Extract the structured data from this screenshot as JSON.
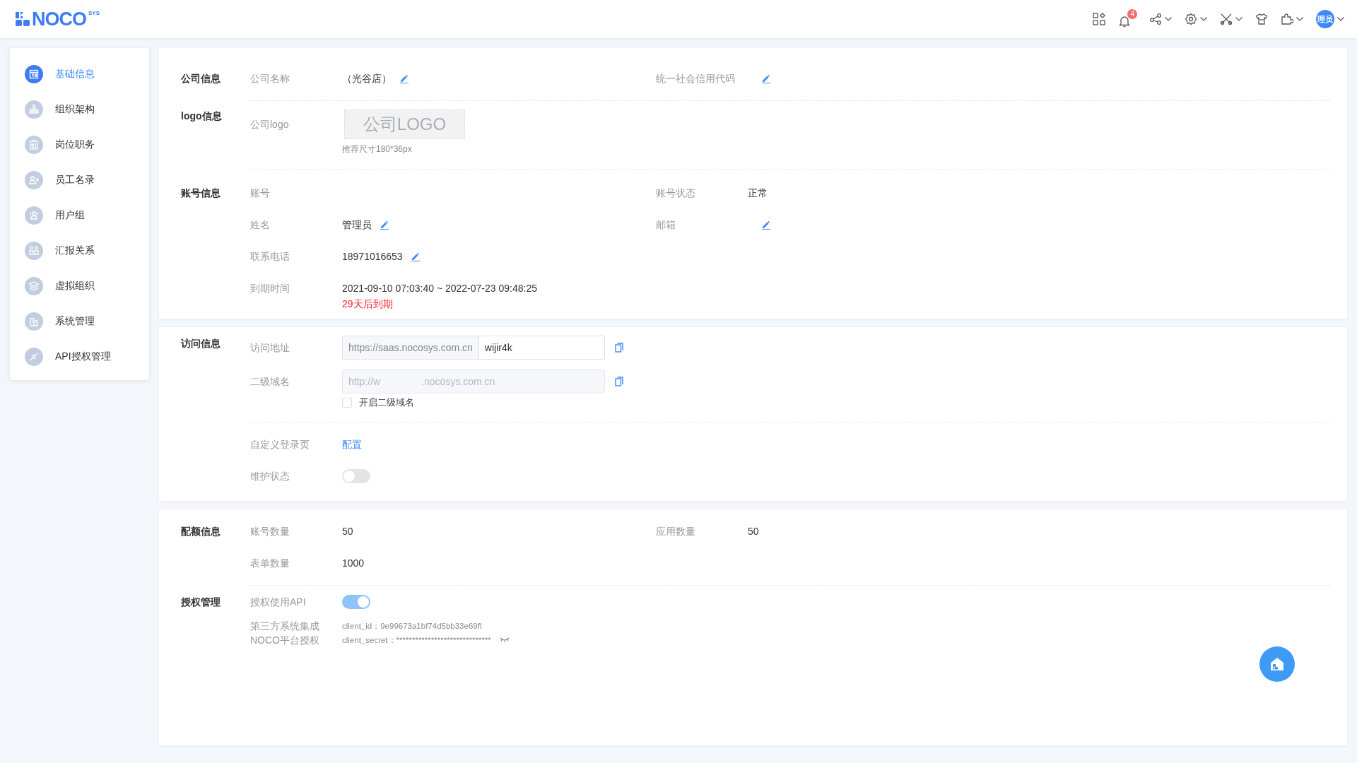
{
  "header": {
    "logo": "NOCO",
    "logo_sup": "SYS",
    "tools": [
      {
        "kind": "apps",
        "dropdown": false
      },
      {
        "kind": "bell",
        "dropdown": false,
        "badge": "4"
      },
      {
        "kind": "share",
        "dropdown": true
      },
      {
        "kind": "gear",
        "dropdown": true
      },
      {
        "kind": "tools",
        "dropdown": true
      },
      {
        "kind": "shirt",
        "dropdown": false
      },
      {
        "kind": "puzzle",
        "dropdown": true
      }
    ],
    "avatar": {
      "text": "理员",
      "dropdown": true
    }
  },
  "sidebar": {
    "items": [
      {
        "label": "基础信息",
        "selected": true,
        "kind": "form"
      },
      {
        "label": "组织架构",
        "selected": false,
        "kind": "org"
      },
      {
        "label": "岗位职务",
        "selected": false,
        "kind": "post"
      },
      {
        "label": "员工名录",
        "selected": false,
        "kind": "staff"
      },
      {
        "label": "用户组",
        "selected": false,
        "kind": "group"
      },
      {
        "label": "汇报关系",
        "selected": false,
        "kind": "report"
      },
      {
        "label": "虚拟组织",
        "selected": false,
        "kind": "layers"
      },
      {
        "label": "系统管理",
        "selected": false,
        "kind": "system"
      },
      {
        "label": "API授权管理",
        "selected": false,
        "kind": "api"
      }
    ]
  },
  "panels": [
    {
      "sections": [
        {
          "title": "公司信息",
          "rows": [
            [
              {
                "kind": "text",
                "label": "公司名称",
                "value": "（光谷店）",
                "editable": true
              },
              {
                "kind": "text",
                "label": "统一社会信用代码",
                "editable": true
              }
            ]
          ]
        },
        {
          "title": "logo信息",
          "rows": [
            [
              {
                "kind": "logo",
                "label": "公司logo",
                "placeholder": "公司LOGO",
                "hint": "推荐尺寸180*36px"
              }
            ]
          ]
        },
        {
          "title": "账号信息",
          "rows": [
            [
              {
                "kind": "text",
                "label": "账号"
              },
              {
                "kind": "text",
                "label": "账号状态",
                "value": "正常"
              }
            ],
            [
              {
                "kind": "text",
                "label": "姓名",
                "value": "管理员",
                "editable": true
              },
              {
                "kind": "text",
                "label": "邮箱",
                "editable": true
              }
            ],
            [
              {
                "kind": "text",
                "label": "联系电话",
                "value": "18971016653",
                "editable": true
              }
            ],
            [
              {
                "kind": "expiry",
                "label": "到期时间",
                "value": "2021-09-10 07:03:40 ~ 2022-07-23 09:48:25",
                "note": "29天后到期"
              }
            ]
          ]
        }
      ]
    },
    {
      "sections": [
        {
          "title": "访问信息",
          "rows": [
            [
              {
                "kind": "url",
                "label": "访问地址",
                "prefix": "https://saas.nocosys.com.cn",
                "value": "wijir4k"
              }
            ],
            [
              {
                "kind": "domain",
                "label": "二级域名",
                "value_start": "http://w",
                "value_end": ".nocosys.com.cn",
                "checkbox": {
                  "label": "开启二级域名",
                  "checked": false
                }
              }
            ]
          ]
        },
        {
          "rows": [
            [
              {
                "kind": "link",
                "label": "自定义登录页",
                "value": "配置"
              }
            ],
            [
              {
                "kind": "switch",
                "label": "维护状态",
                "on": false
              }
            ]
          ]
        }
      ]
    },
    {
      "sections": [
        {
          "title": "配额信息",
          "rows": [
            [
              {
                "kind": "text",
                "label": "账号数量",
                "value": "50"
              },
              {
                "kind": "text",
                "label": "应用数量",
                "value": "50"
              }
            ],
            [
              {
                "kind": "text",
                "label": "表单数量",
                "value": "1000"
              }
            ]
          ]
        },
        {
          "title": "授权管理",
          "rows": [
            [
              {
                "kind": "switch",
                "label": "授权使用API",
                "on": true
              }
            ],
            [
              {
                "kind": "client",
                "label_lines": [
                  "第三方系统集成",
                  "NOCO平台授权"
                ],
                "lines": [
                  {
                    "text": "client_id：9e99673a1bf74d5bb33e69fl"
                  },
                  {
                    "text": "client_secret：******************************",
                    "masked": true
                  }
                ]
              }
            ]
          ]
        }
      ]
    }
  ]
}
